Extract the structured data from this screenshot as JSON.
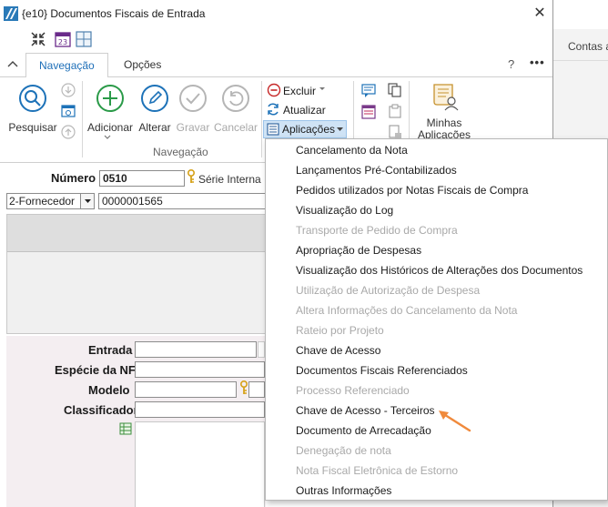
{
  "window": {
    "title": "{e10}  Documentos Fiscais de Entrada",
    "close_symbol": "✕"
  },
  "background_app": {
    "tab_label": "Contas a"
  },
  "tabs": {
    "navigation": "Navegação",
    "options": "Opções",
    "help": "?",
    "more": "•••"
  },
  "ribbon": {
    "search": "Pesquisar",
    "add": "Adicionar",
    "edit": "Alterar",
    "save": "Gravar",
    "cancel": "Cancelar",
    "group_label": "Navegação",
    "delete": "Excluir",
    "refresh": "Atualizar",
    "applications": "Aplicações",
    "my_apps_line1": "Minhas",
    "my_apps_line2": "Aplicações"
  },
  "form": {
    "number_label": "Número",
    "number_value": "0510",
    "serie_label": "Série Interna",
    "supplier_type": "2-Fornecedor",
    "supplier_code": "0000001565",
    "entry_label": "Entrada",
    "species_label": "Espécie da NF",
    "model_label": "Modelo",
    "classifier_label": "Classificador"
  },
  "menu": {
    "items": [
      {
        "label": "Cancelamento da Nota",
        "enabled": true
      },
      {
        "label": "Lançamentos Pré-Contabilizados",
        "enabled": true
      },
      {
        "label": "Pedidos utilizados por Notas Fiscais de Compra",
        "enabled": true
      },
      {
        "label": "Visualização do Log",
        "enabled": true
      },
      {
        "label": "Transporte de Pedido de Compra",
        "enabled": false
      },
      {
        "label": "Apropriação de Despesas",
        "enabled": true
      },
      {
        "label": "Visualização dos Históricos de Alterações dos Documentos",
        "enabled": true
      },
      {
        "label": "Utilização de Autorização de Despesa",
        "enabled": false
      },
      {
        "label": "Altera Informações do Cancelamento da Nota",
        "enabled": false
      },
      {
        "label": "Rateio por Projeto",
        "enabled": false
      },
      {
        "label": "Chave de Acesso",
        "enabled": true
      },
      {
        "label": "Documentos Fiscais Referenciados",
        "enabled": true
      },
      {
        "label": "Processo Referenciado",
        "enabled": false
      },
      {
        "label": "Chave de Acesso - Terceiros",
        "enabled": true
      },
      {
        "label": "Documento de Arrecadação",
        "enabled": true
      },
      {
        "label": "Denegação de nota",
        "enabled": false
      },
      {
        "label": "Nota Fiscal Eletrônica de Estorno",
        "enabled": false
      },
      {
        "label": "Outras Informações",
        "enabled": true
      }
    ]
  },
  "colors": {
    "accent": "#1d72b8",
    "arrow": "#f08a3c",
    "disabled": "#a9a9a9"
  }
}
